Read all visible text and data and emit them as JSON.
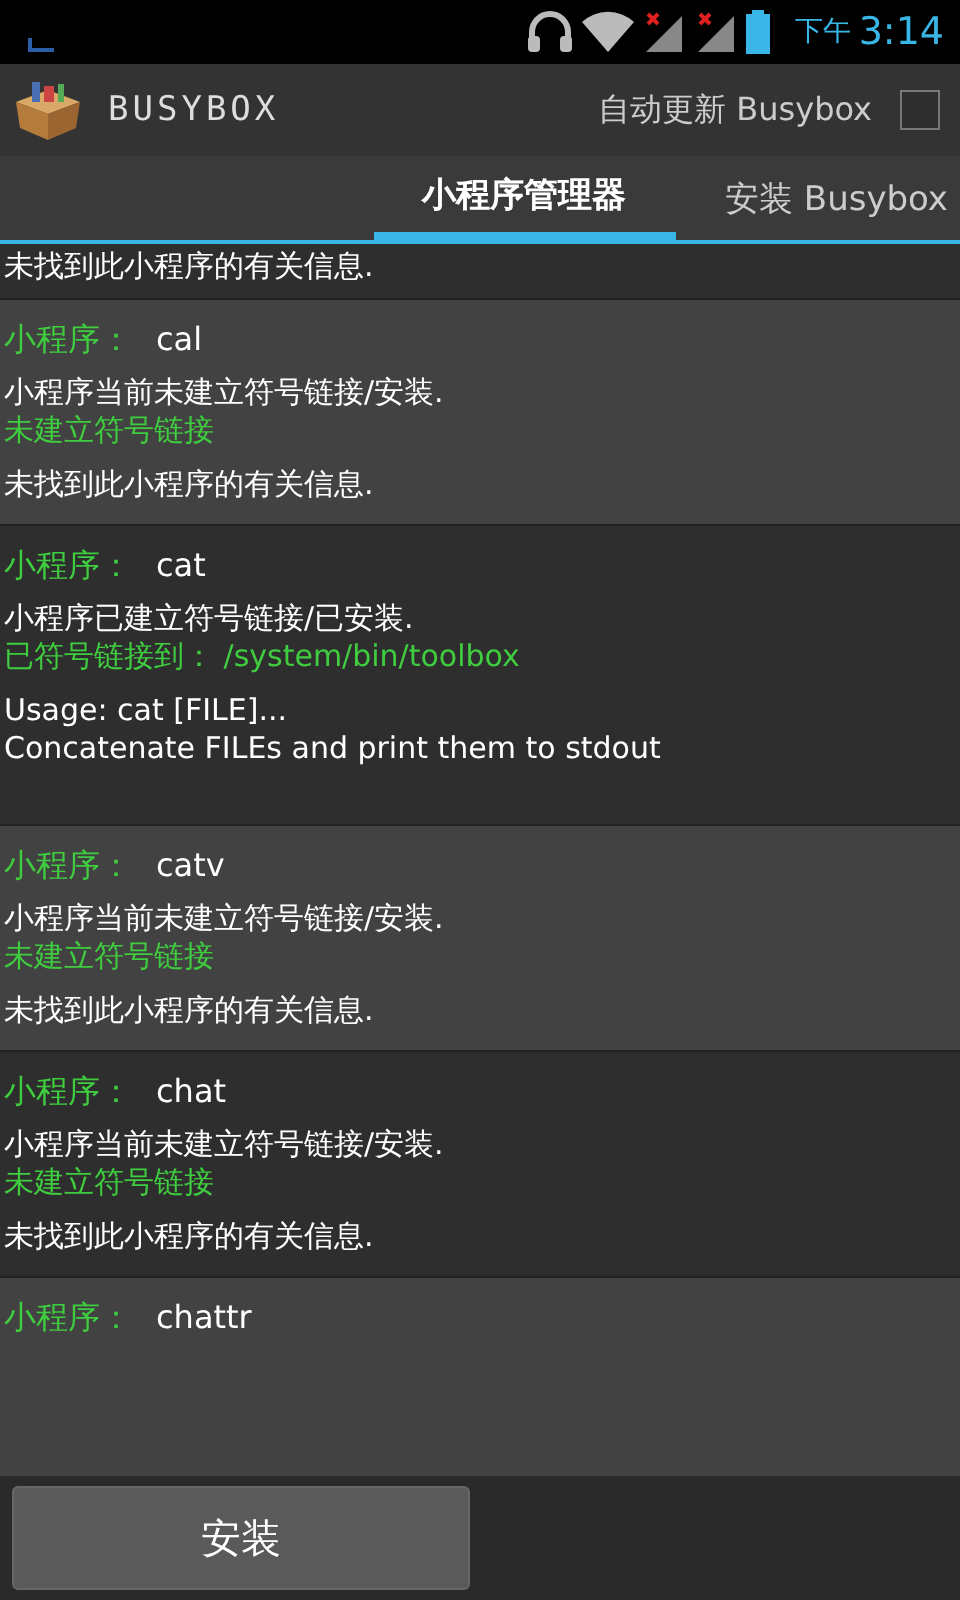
{
  "status_bar": {
    "time_prefix": "下午",
    "time": "3:14"
  },
  "app_bar": {
    "title": "BUSYBOX",
    "auto_update": {
      "label": "自动更新 Busybox",
      "checked": false
    }
  },
  "tabs": [
    {
      "label": "小程序管理器",
      "selected": true
    },
    {
      "label": "安装 Busybox",
      "selected": false
    }
  ],
  "applets": [
    {
      "info": [
        "未找到此小程序的有关信息."
      ]
    },
    {
      "label": "小程序：",
      "name": "cal",
      "status": "小程序当前未建立符号链接/安装.",
      "link": "未建立符号链接",
      "info": [
        "未找到此小程序的有关信息."
      ]
    },
    {
      "label": "小程序：",
      "name": "cat",
      "status": "小程序已建立符号链接/已安装.",
      "link": "已符号链接到： /system/bin/toolbox",
      "info": [
        "Usage: cat [FILE]...",
        "Concatenate FILEs and print them to stdout"
      ]
    },
    {
      "label": "小程序：",
      "name": "catv",
      "status": "小程序当前未建立符号链接/安装.",
      "link": "未建立符号链接",
      "info": [
        "未找到此小程序的有关信息."
      ]
    },
    {
      "label": "小程序：",
      "name": "chat",
      "status": "小程序当前未建立符号链接/安装.",
      "link": "未建立符号链接",
      "info": [
        "未找到此小程序的有关信息."
      ]
    },
    {
      "label": "小程序：",
      "name": "chattr"
    }
  ],
  "buttons": [
    "安装"
  ]
}
